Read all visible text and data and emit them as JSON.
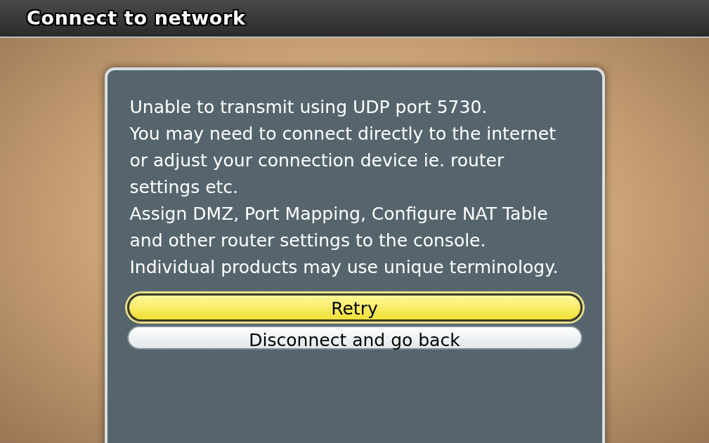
{
  "window": {
    "title": "Connect to network"
  },
  "message": [
    "Unable to transmit using UDP port 5730.",
    "You may need to connect directly to the internet or adjust your connection device ie. router settings etc.",
    "Assign DMZ, Port Mapping, Configure NAT Table and other router settings to the console.",
    "Individual products may use unique terminology."
  ],
  "buttons": [
    {
      "label": "Retry",
      "selected": true
    },
    {
      "label": "Disconnect and go back",
      "selected": false
    }
  ]
}
